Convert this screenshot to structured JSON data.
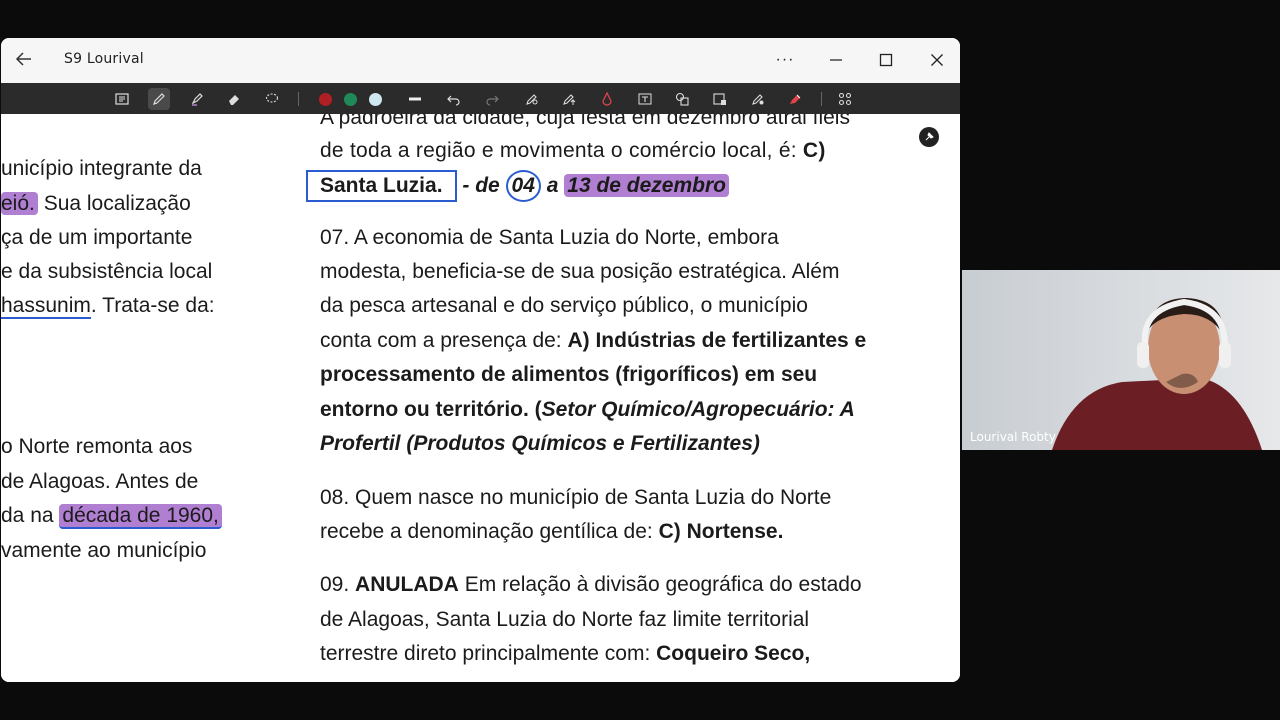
{
  "window": {
    "title": "S9  Lourival",
    "more_label": "···"
  },
  "toolbar": {
    "colors": [
      "#b01f24",
      "#1f8a57",
      "#cfe8f0"
    ]
  },
  "document": {
    "left_column": [
      "unicípio  integrante  da",
      "eió.",
      " Sua   localização",
      "ça  de  um  importante",
      "e da subsistência local",
      "hassunim",
      ". Trata-se da:",
      "o  Norte  remonta  aos",
      " de  Alagoas.  Antes  de",
      "da na ",
      "década de 1960,",
      "vamente ao município"
    ],
    "q06": {
      "line1": "A padroeira da cidade, cuja festa em dezembro atrai fiéis",
      "line2_a": "de toda a região e movimenta o comércio local, é: ",
      "line2_b": "C)",
      "answer": "Santa Luzia.",
      "date_a": " - de ",
      "date_b": "04",
      "date_c": " a ",
      "date_hl": "13 de dezembro "
    },
    "q07": {
      "line1": "07.  A  economia  de  Santa  Luzia  do  Norte,  embora",
      "line2": "modesta, beneficia-se de sua posição estratégica. Além",
      "line3": "da  pesca  artesanal  e  do  serviço  público,  o  município",
      "line4_a": "conta com a presença de: ",
      "line4_b": "A) Indústrias de fertilizantes e",
      "line5": "processamento  de  alimentos  (frigoríficos)  em  seu",
      "line6_a": "entorno ou território. (",
      "line6_b": "Setor Químico/Agropecuário: A",
      "line7": "Profertil (Produtos Químicos e Fertilizantes)"
    },
    "q08": {
      "line1": "08. Quem nasce no município de Santa Luzia do Norte",
      "line2_a": "recebe a denominação gentílica de: ",
      "line2_b": "C) Nortense."
    },
    "q09": {
      "line1_a": "09. ",
      "line1_b": "ANULADA",
      "line1_c": " Em relação à divisão geográfica do estado",
      "line2": "de  Alagoas,  Santa  Luzia  do  Norte  faz  limite  territorial",
      "line3_a": "terrestre  direto  principalmente  com:  ",
      "line3_b": "Coqueiro  Seco,"
    }
  },
  "webcam": {
    "name": "Lourival Robty"
  }
}
